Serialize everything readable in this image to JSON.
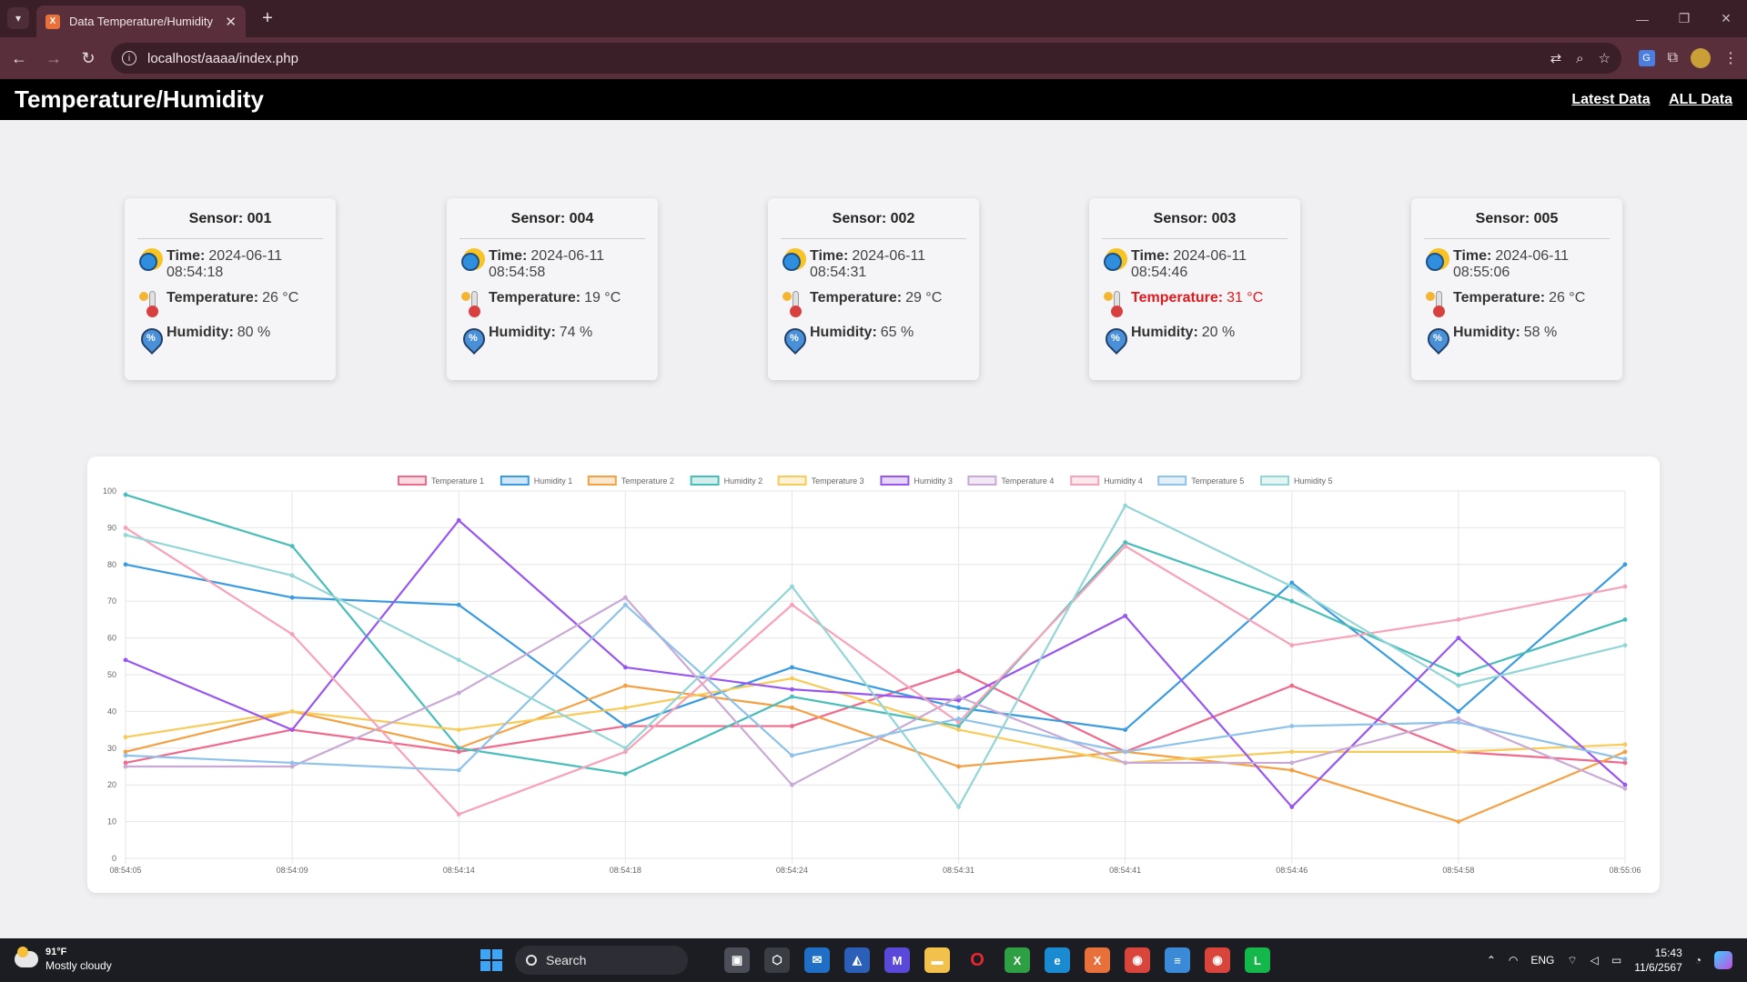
{
  "browser": {
    "tab_title": "Data Temperature/Humidity",
    "url": "localhost/aaaa/index.php"
  },
  "site": {
    "title": "Temperature/Humidity",
    "nav": [
      {
        "label": "Latest Data"
      },
      {
        "label": "ALL Data"
      }
    ]
  },
  "labels": {
    "time": "Time:",
    "temperature": "Temperature:",
    "humidity": "Humidity:"
  },
  "sensors": [
    {
      "title": "Sensor: 001",
      "time": "2024-06-11 08:54:18",
      "temperature": "26 °C",
      "humidity": "80 %",
      "alert": false
    },
    {
      "title": "Sensor: 004",
      "time": "2024-06-11 08:54:58",
      "temperature": "19 °C",
      "humidity": "74 %",
      "alert": false
    },
    {
      "title": "Sensor: 002",
      "time": "2024-06-11 08:54:31",
      "temperature": "29 °C",
      "humidity": "65 %",
      "alert": false
    },
    {
      "title": "Sensor: 003",
      "time": "2024-06-11 08:54:46",
      "temperature": "31 °C",
      "humidity": "20 %",
      "alert": true
    },
    {
      "title": "Sensor: 005",
      "time": "2024-06-11 08:55:06",
      "temperature": "26 °C",
      "humidity": "58 %",
      "alert": false
    }
  ],
  "colors": {
    "alert": "#e0191f"
  },
  "chart_data": {
    "type": "line",
    "categories": [
      "08:54:05",
      "08:54:09",
      "08:54:14",
      "08:54:18",
      "08:54:24",
      "08:54:31",
      "08:54:41",
      "08:54:46",
      "08:54:58",
      "08:55:06"
    ],
    "ylim": [
      0,
      100
    ],
    "yticks": [
      0,
      10,
      20,
      30,
      40,
      50,
      60,
      70,
      80,
      90,
      100
    ],
    "grid": true,
    "legend_position": "top",
    "series": [
      {
        "name": "Temperature 1",
        "color": "#f06a8c",
        "values": [
          26,
          35,
          29,
          36,
          36,
          51,
          29,
          47,
          29,
          26
        ]
      },
      {
        "name": "Humidity 1",
        "color": "#3a9be0",
        "values": [
          80,
          71,
          69,
          36,
          52,
          41,
          35,
          75,
          40,
          80
        ]
      },
      {
        "name": "Temperature 2",
        "color": "#f5a043",
        "values": [
          29,
          40,
          30,
          47,
          41,
          25,
          29,
          24,
          10,
          29
        ]
      },
      {
        "name": "Humidity 2",
        "color": "#48bdb9",
        "values": [
          99,
          85,
          30,
          23,
          44,
          36,
          86,
          70,
          50,
          65
        ]
      },
      {
        "name": "Temperature 3",
        "color": "#f8cb59",
        "values": [
          33,
          40,
          35,
          41,
          49,
          35,
          26,
          29,
          29,
          31
        ]
      },
      {
        "name": "Humidity 3",
        "color": "#9856f0",
        "values": [
          54,
          35,
          92,
          52,
          46,
          43,
          66,
          14,
          60,
          20
        ]
      },
      {
        "name": "Temperature 4",
        "color": "#c9a9d6",
        "values": [
          25,
          25,
          45,
          71,
          20,
          44,
          26,
          26,
          38,
          19
        ]
      },
      {
        "name": "Humidity 4",
        "color": "#f7a2b8",
        "values": [
          90,
          61,
          12,
          29,
          69,
          37,
          85,
          58,
          65,
          74
        ]
      },
      {
        "name": "Temperature 5",
        "color": "#8ec2ea",
        "values": [
          28,
          26,
          24,
          69,
          28,
          38,
          29,
          36,
          37,
          27
        ]
      },
      {
        "name": "Humidity 5",
        "color": "#93d6d5",
        "values": [
          88,
          77,
          54,
          30,
          74,
          14,
          96,
          74,
          47,
          58
        ]
      }
    ]
  },
  "taskbar": {
    "weather_temp": "91°F",
    "weather_desc": "Mostly cloudy",
    "search": "Search",
    "lang": "ENG",
    "time": "15:43",
    "date": "11/6/2567"
  }
}
